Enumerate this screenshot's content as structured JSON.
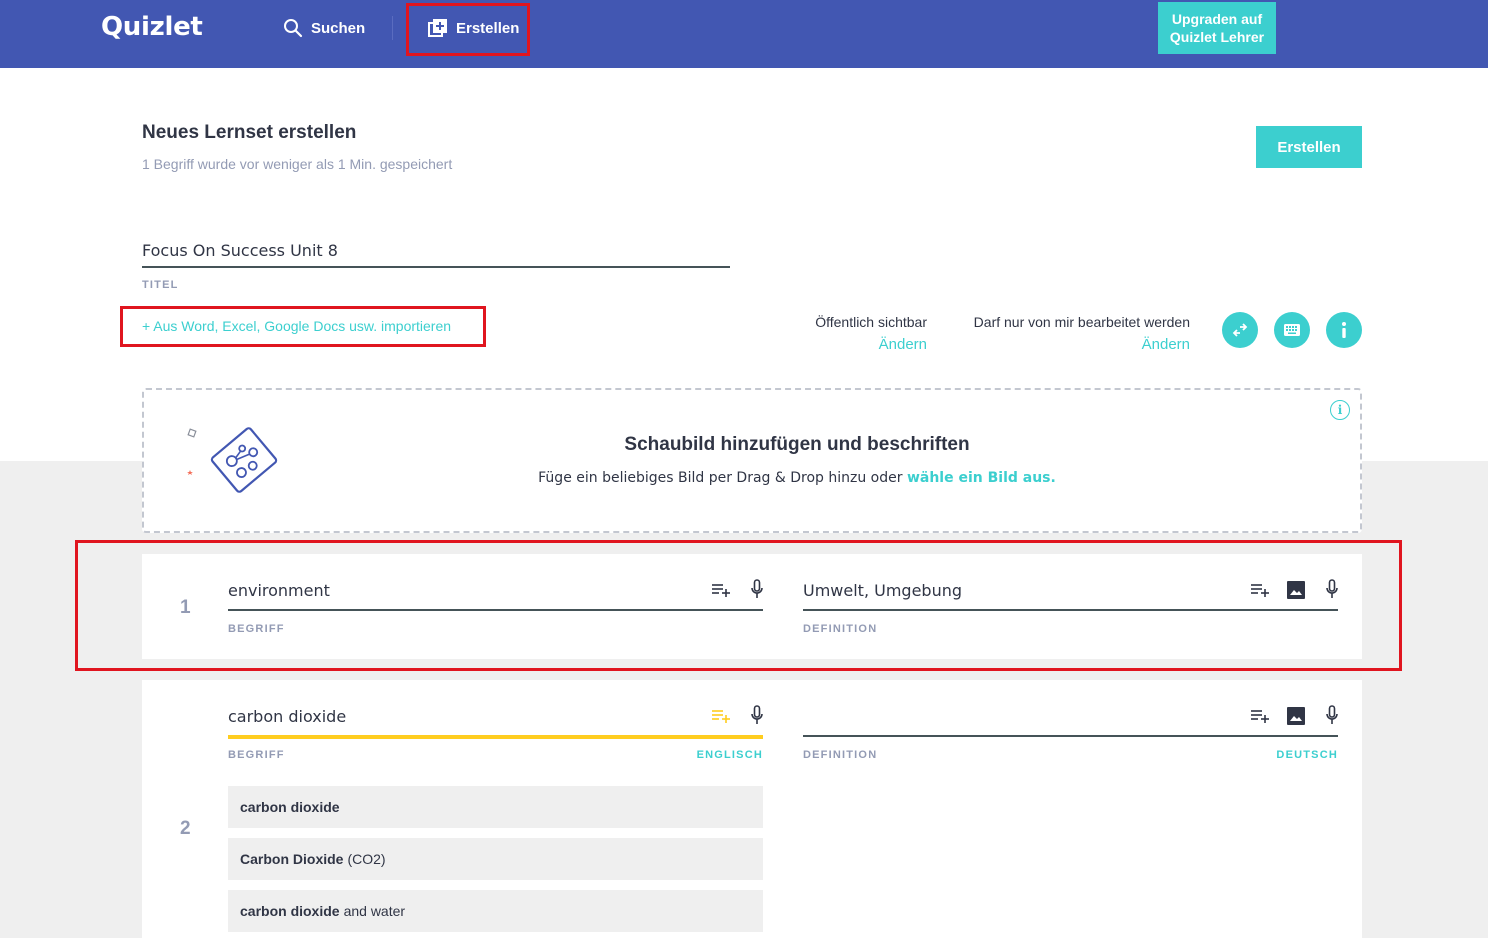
{
  "header": {
    "logo": "Quizlet",
    "search_label": "Suchen",
    "create_label": "Erstellen",
    "upgrade_label_line1": "Upgraden auf",
    "upgrade_label_line2": "Quizlet Lehrer"
  },
  "page": {
    "title": "Neues Lernset erstellen",
    "save_status": "1 Begriff wurde vor weniger als 1 Min. gespeichert",
    "create_button": "Erstellen"
  },
  "set_title": {
    "value": "Focus On Success Unit 8",
    "label": "TITEL"
  },
  "import_link": "+ Aus Word, Excel, Google Docs usw. importieren",
  "settings": {
    "visibility_label": "Öffentlich sichtbar",
    "visibility_change": "Ändern",
    "edit_label": "Darf nur von mir bearbeitet werden",
    "edit_change": "Ändern",
    "icons": [
      "swap-icon",
      "keyboard-icon",
      "info-icon"
    ]
  },
  "diagram": {
    "title": "Schaubild hinzufügen und beschriften",
    "text": "Füge ein beliebiges Bild per Drag & Drop hinzu oder ",
    "link": "wähle ein Bild aus.",
    "info_glyph": "i"
  },
  "cards": [
    {
      "number": "1",
      "term": "environment",
      "term_label": "BEGRIFF",
      "definition": "Umwelt, Umgebung",
      "definition_label": "DEFINITION"
    },
    {
      "number": "2",
      "term": "carbon dioxide",
      "term_label": "BEGRIFF",
      "term_language": "ENGLISCH",
      "definition": "",
      "definition_label": "DEFINITION",
      "definition_language": "DEUTSCH",
      "suggestions": [
        {
          "bold": "carbon dioxide",
          "rest": ""
        },
        {
          "bold": "Carbon Dioxide",
          "rest": "(CO2)"
        },
        {
          "bold": "carbon dioxide",
          "rest": "and water"
        }
      ]
    }
  ],
  "colors": {
    "brand": "#4257b2",
    "accent": "#3ccfcf",
    "highlight": "#ffcd1f",
    "annotation_red": "#e0151f"
  }
}
